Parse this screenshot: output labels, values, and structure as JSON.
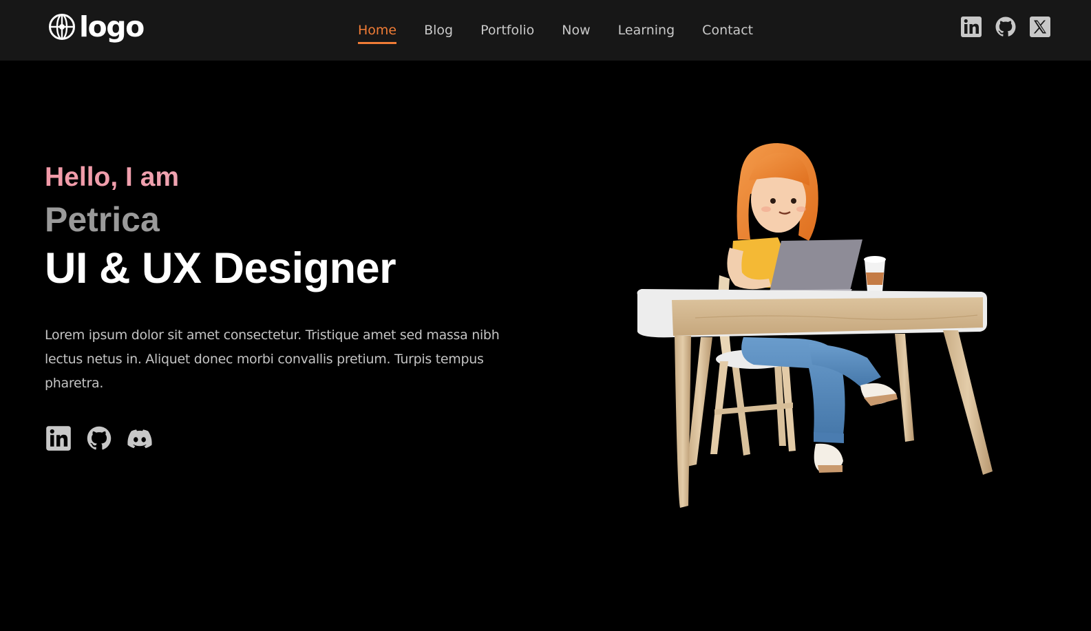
{
  "header": {
    "logo_text": "logo",
    "nav": [
      {
        "label": "Home",
        "active": true
      },
      {
        "label": "Blog",
        "active": false
      },
      {
        "label": "Portfolio",
        "active": false
      },
      {
        "label": "Now",
        "active": false
      },
      {
        "label": "Learning",
        "active": false
      },
      {
        "label": "Contact",
        "active": false
      }
    ],
    "social": [
      "linkedin-icon",
      "github-icon",
      "x-icon"
    ]
  },
  "hero": {
    "greeting": "Hello, I am",
    "name": "Petrica",
    "role": "UI & UX Designer",
    "bio": "Lorem ipsum dolor sit amet consectetur. Tristique amet sed massa nibh lectus netus in. Aliquet donec morbi convallis pretium. Turpis tempus pharetra.",
    "social": [
      "linkedin-icon",
      "github-icon",
      "discord-icon"
    ]
  },
  "colors": {
    "accent": "#f07c36",
    "header_bg": "#171717",
    "page_bg": "#000000",
    "greeting_gradient": [
      "#f29aa8",
      "#e6b8c5"
    ]
  }
}
